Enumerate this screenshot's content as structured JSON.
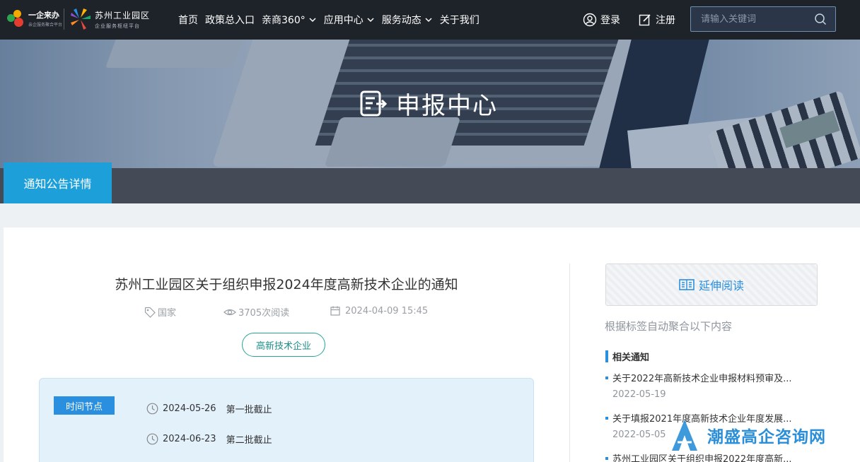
{
  "header": {
    "logo1": {
      "name": "一企来办",
      "slogan": "亲企服务聚合平台"
    },
    "logo2": {
      "name": "苏州工业园区",
      "slogan": "企业服务枢纽平台"
    },
    "nav": [
      {
        "label": "首页",
        "dropdown": false
      },
      {
        "label": "政策总入口",
        "dropdown": false
      },
      {
        "label": "亲商360°",
        "dropdown": true
      },
      {
        "label": "应用中心",
        "dropdown": true
      },
      {
        "label": "服务动态",
        "dropdown": true
      },
      {
        "label": "关于我们",
        "dropdown": false
      }
    ],
    "login_label": "登录",
    "register_label": "注册",
    "search": {
      "placeholder": "请输入关键词"
    }
  },
  "banner": {
    "title": "申报中心"
  },
  "tabs": {
    "active_label": "通知公告详情"
  },
  "article": {
    "title": "苏州工业园区关于组织申报2024年度高新技术企业的通知",
    "meta": {
      "category": "国家",
      "views": "3705次阅读",
      "datetime": "2024-04-09 15:45"
    },
    "tag": "高新技术企业",
    "timeline": {
      "label": "时间节点",
      "items": [
        {
          "date": "2024-05-26",
          "desc": "第一批截止"
        },
        {
          "date": "2024-06-23",
          "desc": "第二批截止"
        }
      ]
    }
  },
  "sidebar": {
    "extended_label": "延伸阅读",
    "note": "根据标签自动聚合以下内容",
    "section_title": "相关通知",
    "items": [
      {
        "title": "关于2022年高新技术企业申报材料预审及...",
        "date": "2022-05-19"
      },
      {
        "title": "关于填报2021年度高新技术企业年度发展...",
        "date": "2022-05-05"
      },
      {
        "title": "苏州工业园区关于组织申报2022年度高新...",
        "date": ""
      }
    ]
  },
  "watermark": {
    "text": "潮盛高企咨询网"
  },
  "colors": {
    "accent": "#1da0d9",
    "header_bg": "#1e2229",
    "link_blue": "#2b8fe0",
    "tag_green": "#26a39a"
  }
}
